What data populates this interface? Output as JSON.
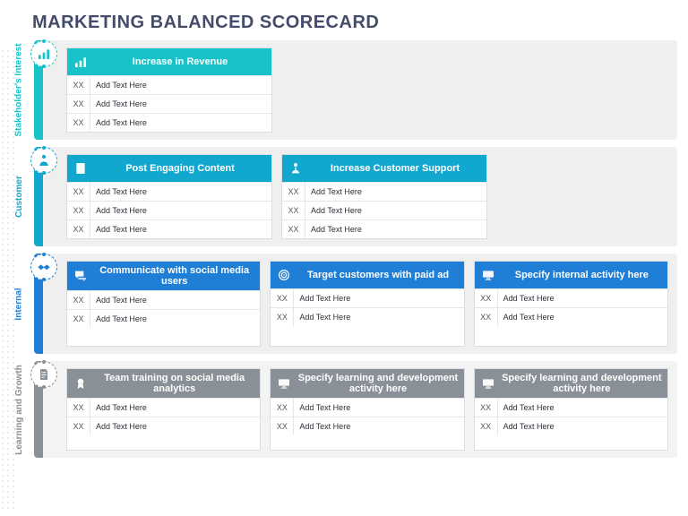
{
  "title": "MARKETING BALANCED SCORECARD",
  "xx": "XX",
  "placeholder": "Add Text Here",
  "perspectives": [
    {
      "id": "stakeholders-interest",
      "label": "Stakeholder's Interest",
      "colorClass": "0",
      "icon": "bars-up",
      "cards": [
        {
          "icon": "bars-up",
          "title": "Increase in Revenue",
          "rows": 3
        }
      ]
    },
    {
      "id": "customer",
      "label": "Customer",
      "colorClass": "1",
      "icon": "person",
      "cards": [
        {
          "icon": "doc-star",
          "title": "Post Engaging Content",
          "rows": 3
        },
        {
          "icon": "support",
          "title": "Increase Customer Support",
          "rows": 3
        }
      ]
    },
    {
      "id": "internal",
      "label": "Internal",
      "colorClass": "2",
      "icon": "handshake",
      "cards": [
        {
          "icon": "chat",
          "title": "Communicate with social media users",
          "rows": 2
        },
        {
          "icon": "target",
          "title": "Target customers with paid ad",
          "rows": 2
        },
        {
          "icon": "screen",
          "title": "Specify internal activity here",
          "rows": 2
        }
      ]
    },
    {
      "id": "learning-and-growth",
      "label": "Learning and Growth",
      "colorClass": "3",
      "icon": "doc",
      "cards": [
        {
          "icon": "badge",
          "title": "Team training on social media analytics",
          "rows": 2
        },
        {
          "icon": "screen",
          "title": "Specify learning and development activity here",
          "rows": 2
        },
        {
          "icon": "screen",
          "title": "Specify learning and development activity here",
          "rows": 2
        }
      ]
    }
  ]
}
